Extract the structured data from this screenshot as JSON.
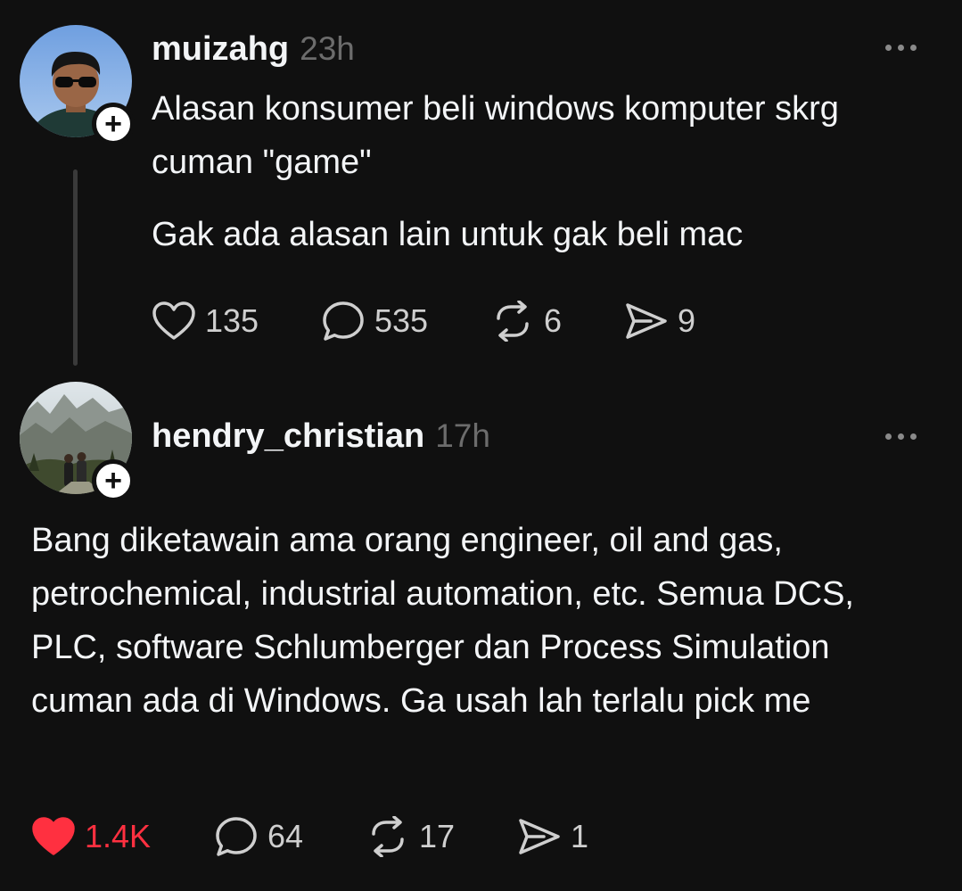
{
  "posts": [
    {
      "username": "muizahg",
      "time": "23h",
      "paragraphs": [
        "Alasan konsumer beli windows komputer skrg cuman \"game\"",
        "Gak ada alasan lain untuk gak beli mac"
      ],
      "likes": "135",
      "replies": "535",
      "reposts": "6",
      "shares": "9",
      "liked": false
    },
    {
      "username": "hendry_christian",
      "time": "17h",
      "paragraphs": [
        "Bang diketawain ama orang engineer, oil and gas, petrochemical, industrial automation, etc. Semua DCS, PLC, software Schlumberger dan Process Simulation cuman ada di Windows. Ga usah lah terlalu pick me"
      ],
      "likes": "1.4K",
      "replies": "64",
      "reposts": "17",
      "shares": "1",
      "liked": true
    }
  ],
  "colors": {
    "background": "#101010",
    "text": "#f3f5f7",
    "muted": "#6c6c6c",
    "liked": "#ff3040",
    "icon": "#cfcfcf"
  },
  "icons": {
    "like": "heart-icon",
    "reply": "speech-bubble-icon",
    "repost": "repost-arrows-icon",
    "share": "paper-plane-icon",
    "more": "ellipsis-icon",
    "follow": "plus-icon"
  }
}
